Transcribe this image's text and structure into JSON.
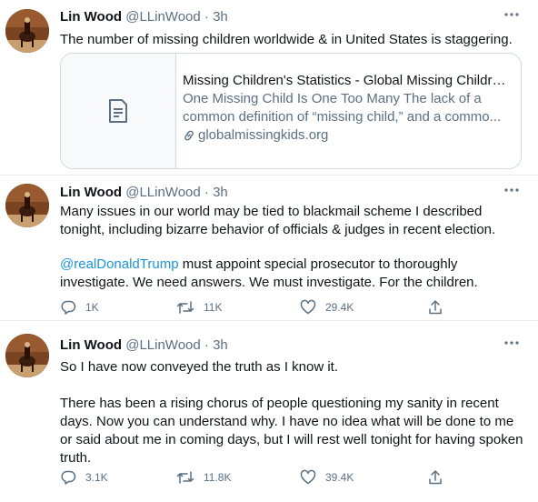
{
  "tweets": [
    {
      "name": "Lin Wood",
      "handle": "@LLinWood",
      "separator": "·",
      "time": "3h",
      "more_icon": "more-dots-icon",
      "text": "The number of missing children worldwide & in United States is staggering.",
      "card": {
        "title": "Missing Children's Statistics - Global Missing Childre...",
        "description": "One Missing Child Is One Too Many The lack of a common definition of “missing child,” and a commo...",
        "domain": "globalmissingkids.org",
        "thumb_icon": "document-icon",
        "link_icon": "link-icon"
      }
    },
    {
      "name": "Lin Wood",
      "handle": "@LLinWood",
      "separator": "·",
      "time": "3h",
      "text_p1": "Many issues in our world may be tied to blackmail scheme I described tonight, including bizarre behavior of officials & judges in recent election.",
      "mention": "@realDonaldTrump",
      "text_p2_rest": " must appoint special prosecutor to thoroughly investigate. We need answers. We must investigate. For the children.",
      "replies": "1K",
      "retweets": "11K",
      "likes": "29.4K"
    },
    {
      "name": "Lin Wood",
      "handle": "@LLinWood",
      "separator": "·",
      "time": "3h",
      "text_p1": "So I have now conveyed the truth as I know it.",
      "text_p2": "There has been a rising chorus of people questioning my sanity in recent days. Now you can understand why. I have no idea what will be done to me or said about me in coming days, but I will rest well tonight for having spoken truth.",
      "replies": "3.1K",
      "retweets": "11.8K",
      "likes": "39.4K"
    }
  ],
  "colors": {
    "link": "#1b95e0",
    "muted": "#5b7083",
    "divider": "#e6ecf0"
  }
}
